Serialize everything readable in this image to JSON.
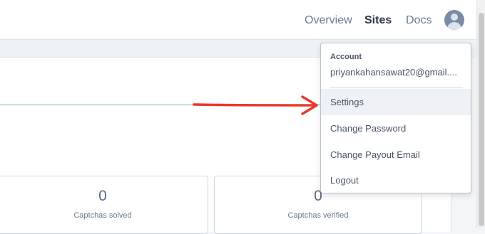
{
  "nav": {
    "links": [
      "Overview",
      "Sites",
      "Docs"
    ],
    "active": "Sites",
    "avatar_icon": "user-avatar-icon"
  },
  "dropdown": {
    "section_title": "Account",
    "email": "priyankahansawat20@gmail....",
    "items": [
      "Settings",
      "Change Password",
      "Change Payout Email",
      "Logout"
    ],
    "highlighted": "Settings"
  },
  "stats": [
    {
      "value": "0",
      "label": "Captchas solved"
    },
    {
      "value": "0",
      "label": "Captchas verified"
    }
  ],
  "annotation": {
    "icon": "red-arrow-icon",
    "color": "#e53b2f"
  },
  "colors": {
    "chart_line": "#54c7b5",
    "accent_text": "#2d3748"
  }
}
